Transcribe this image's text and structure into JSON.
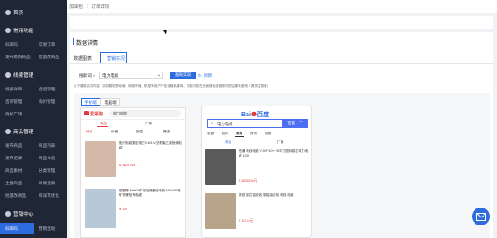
{
  "sidebar": {
    "home": "首页",
    "common": "常用功能",
    "common_links": [
      "扫单码",
      "交易订单",
      "发布易购商品",
      "批量改商品"
    ],
    "leads": "线索管理",
    "leads_links": [
      "线索详单",
      "通话管理",
      "咨询管理",
      "询价管理",
      "商机广场"
    ],
    "product": "商品管理",
    "product_links": [
      "发布商品",
      "商品列表",
      "发布记录",
      "商品体验",
      "商品素材",
      "分类管理",
      "主推商品",
      "关联搜索",
      "批量改商品",
      "商详页优化"
    ],
    "marketing": "营销中心",
    "marketing_links": [
      "扫单码",
      "营销活动"
    ]
  },
  "topbar": {
    "crumb1": "加油包",
    "crumb2": "订单详情"
  },
  "detail": {
    "title": "数据详情",
    "tab1": "数据图表",
    "tab2": "营销实况",
    "select_label": "搜索词",
    "search_value": "电力电缆",
    "query_btn": "查询实况",
    "refresh": "刷新",
    "note": "以下展现实况内容，实际展现受地域、网络环境、机型等用户个性化隐私影响，可能与您在页面搜索该推搜词的结果有差别（请关注搜索）",
    "device_tab1": "手机端",
    "device_tab2": "电脑端"
  },
  "phone1": {
    "logo": "爱采购",
    "search": "电力电缆",
    "tabs": [
      "商品",
      "厂家"
    ],
    "filters": [
      "综合",
      "价格",
      "销量",
      "筛选"
    ],
    "p1_title": "阻兴电缆额定电压0.6/1kV交联聚乙烯绝缘电缆",
    "p1_price": "¥ 960.00",
    "p2_title": "银额牌 MHYV矿用阻燃通信电缆 MHYVR煤矿防爆信号电缆",
    "p2_price": "¥ 20"
  },
  "phone2": {
    "logo": "百度",
    "search": "电力电缆",
    "search_btn": "百度一下",
    "tabs": [
      "全部",
      "图片",
      "采购",
      "资讯",
      "视频"
    ],
    "sub_tabs": [
      "商品",
      "厂家"
    ],
    "p1_title": "恒通 电线电缆 YJV2*10+1*6平方国标铜芯电力电缆 10米",
    "p1_price": "¥ 583.03/元",
    "p2_title": "铁锐 铜芯铝绞线 铜铝组合线 电线 电缆",
    "p2_price": "¥ 10.0/元"
  },
  "colors": {
    "sidebar": "#1f2636",
    "primary": "#2d6cdf",
    "price": "#e4393c",
    "baidu_red": "#e10602"
  }
}
